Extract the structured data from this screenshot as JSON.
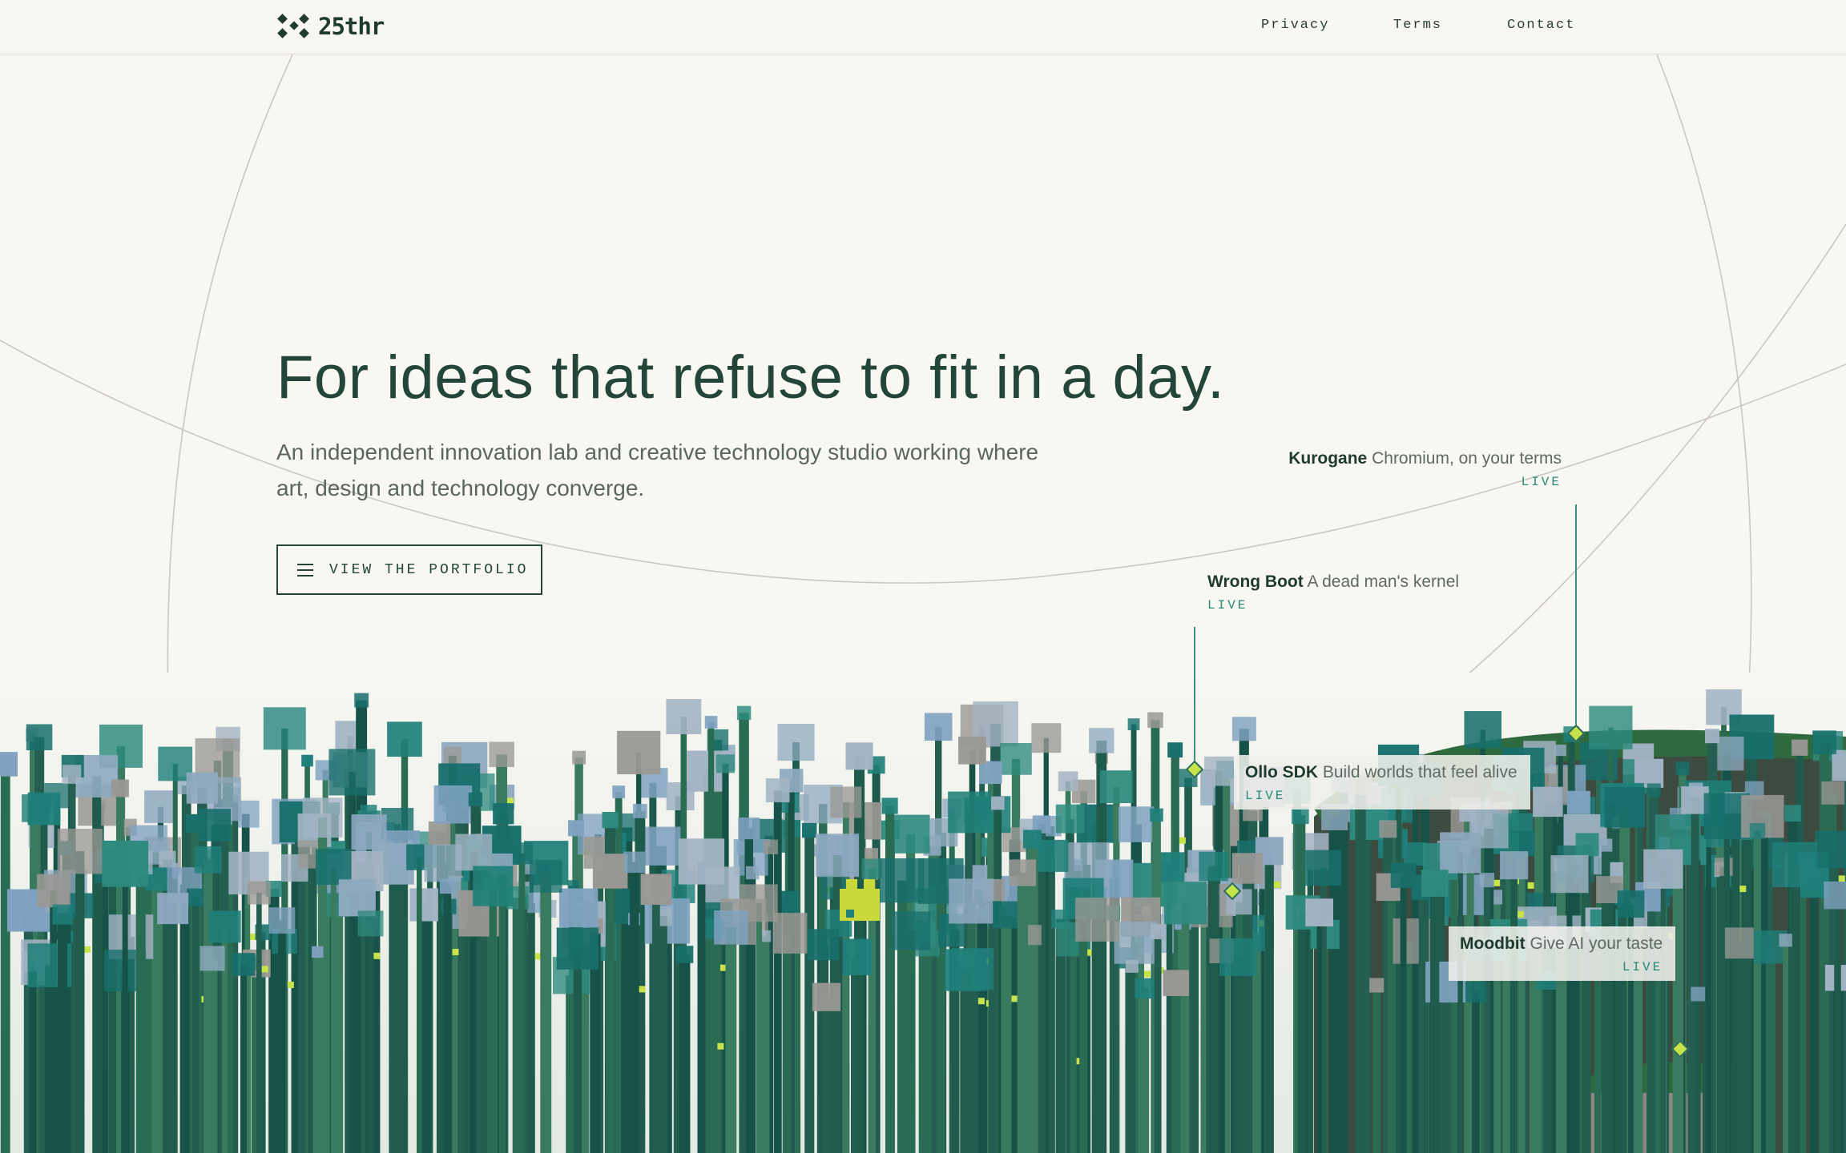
{
  "header": {
    "logo_text": "25thr",
    "nav": {
      "privacy": "Privacy",
      "terms": "Terms",
      "contact": "Contact"
    }
  },
  "hero": {
    "headline": "For ideas that refuse to fit in a day.",
    "subtitle": "An independent innovation lab and creative technology studio working where art, design and technology converge.",
    "cta_label": "VIEW THE PORTFOLIO",
    "cta_icon": "menu-icon"
  },
  "projects": [
    {
      "name": "Kurogane",
      "tagline": "Chromium, on your terms",
      "status": "LIVE"
    },
    {
      "name": "Wrong Boot",
      "tagline": "A dead man's kernel",
      "status": "LIVE"
    },
    {
      "name": "Ollo SDK",
      "tagline": "Build worlds that feel alive",
      "status": "LIVE"
    },
    {
      "name": "Moodbit",
      "tagline": "Give AI your taste",
      "status": "LIVE"
    }
  ],
  "colors": {
    "background": "#f8f7f2",
    "primary_text": "#24463a",
    "status_accent": "#2a8a78",
    "pin_accent": "#c7e34a"
  }
}
